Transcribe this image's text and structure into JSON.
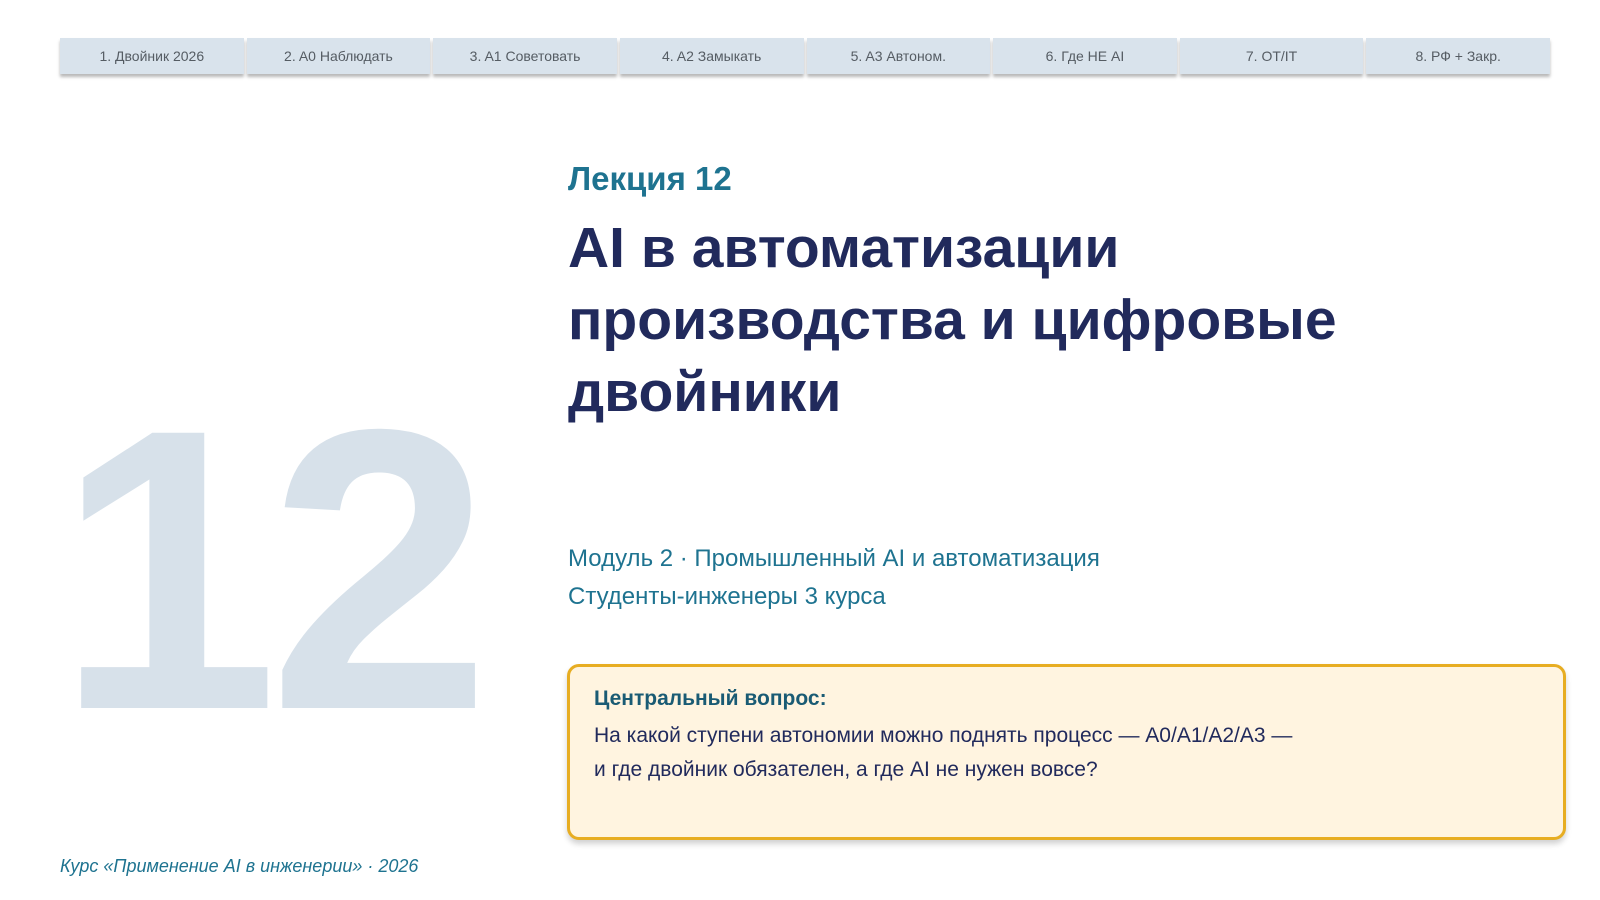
{
  "nav": {
    "tabs": [
      {
        "label": "1. Двойник 2026"
      },
      {
        "label": "2. A0 Наблюдать"
      },
      {
        "label": "3. A1 Советовать"
      },
      {
        "label": "4. A2 Замыкать"
      },
      {
        "label": "5. A3 Автоном."
      },
      {
        "label": "6. Где НЕ AI"
      },
      {
        "label": "7. OT/IT"
      },
      {
        "label": "8. РФ + Закр."
      }
    ]
  },
  "slide": {
    "big_number": "12",
    "lecture_label": "Лекция 12",
    "title_lines": [
      "AI в автоматизации",
      "производства и цифровые",
      "двойники"
    ],
    "module_line": "Модуль 2 · Промышленный AI и автоматизация",
    "audience_line": "Студенты-инженеры 3 курса"
  },
  "question": {
    "label": "Центральный вопрос:",
    "line1": "На какой ступени автономии можно поднять процесс — A0/A1/A2/A3 —",
    "line2": "и где двойник обязателен, а где AI не нужен вовсе?"
  },
  "footer": {
    "text": "Курс «Применение AI в инженерии» · 2026"
  },
  "colors": {
    "title": "#212a5c",
    "accent": "#1e7390",
    "tab_bg": "#d9e3ec",
    "big_number": "#d7e1ea",
    "box_border": "#e7ad22",
    "box_bg": "#fff4e0"
  }
}
